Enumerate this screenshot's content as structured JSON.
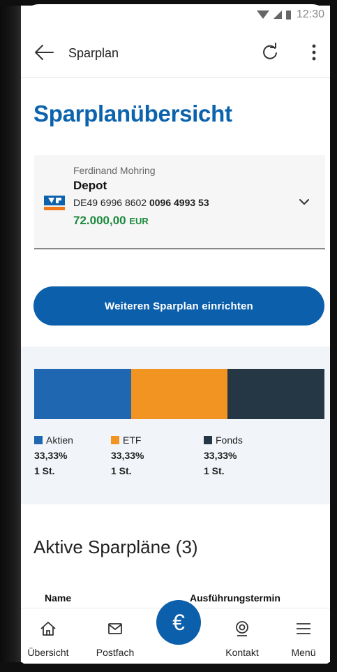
{
  "status_bar": {
    "time": "12:30"
  },
  "topbar": {
    "title": "Sparplan"
  },
  "page": {
    "title": "Sparplanübersicht"
  },
  "account": {
    "owner": "Ferdinand Mohring",
    "name": "Depot",
    "iban_prefix": "DE49 6996 8602",
    "iban_suffix": "0096 4993 53",
    "balance": "72.000,00",
    "currency": "EUR"
  },
  "cta": {
    "label": "Weiteren Sparplan einrichten"
  },
  "chart_data": {
    "type": "bar",
    "stacked": true,
    "categories": [
      "Aktien",
      "ETF",
      "Fonds"
    ],
    "values": [
      33.33,
      33.33,
      33.33
    ],
    "value_labels": [
      "33,33%",
      "33,33%",
      "33,33%"
    ],
    "counts": [
      "1 St.",
      "1 St.",
      "1 St."
    ],
    "colors": [
      "#1f67b0",
      "#f29422",
      "#253744"
    ]
  },
  "section": {
    "title": "Aktive Sparpläne (3)"
  },
  "table": {
    "columns": [
      "Name",
      "Ausführungstermin"
    ]
  },
  "nav": {
    "items": [
      {
        "label": "Übersicht",
        "icon": "home-icon"
      },
      {
        "label": "Postfach",
        "icon": "mail-icon"
      },
      {
        "label": "€",
        "icon": "euro-icon"
      },
      {
        "label": "Kontakt",
        "icon": "contact-icon"
      },
      {
        "label": "Menü",
        "icon": "menu-icon"
      }
    ]
  }
}
